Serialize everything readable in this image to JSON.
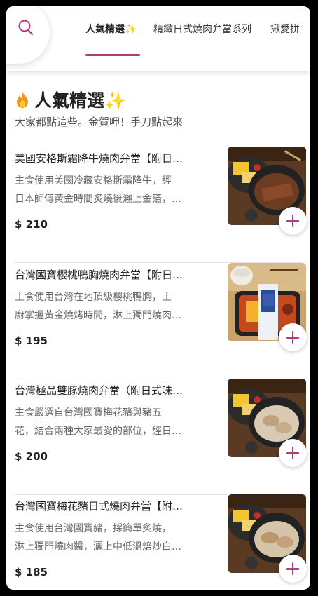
{
  "tabs": [
    {
      "label": "人氣精選✨"
    },
    {
      "label": "精緻日式燒肉弁當系列"
    },
    {
      "label": "揪愛拼"
    }
  ],
  "section": {
    "title": "人氣精選✨",
    "subtitle": "大家都點這些。金賀呷！手刀點起來"
  },
  "items": [
    {
      "name": "美國安格斯霜降牛燒肉弁當【附日…",
      "desc_line1": "主食使用美國冷藏安格斯霜降牛，經",
      "desc_line2": "日本師傅黃金時間炙燒後灑上金箔，…",
      "price": "$ 210"
    },
    {
      "name": "台灣國寶櫻桃鴨胸燒肉弁當【附日…",
      "desc_line1": "主食使用台灣在地頂級櫻桃鴨胸，主",
      "desc_line2": "廚掌握黃金燒烤時間，淋上獨門燒肉…",
      "price": "$ 195"
    },
    {
      "name": "台灣極品雙豚燒肉弁當（附日式味…",
      "desc_line1": "主食嚴選自台灣國寶梅花豬與豬五",
      "desc_line2": "花，結合兩種大家最愛的部位，經日…",
      "price": "$ 200"
    },
    {
      "name": "台灣國寶梅花豬日式燒肉弁當【附…",
      "desc_line1": "主食使用台灣國寶豬，採簡單炙燒，",
      "desc_line2": "淋上獨門燒肉醬，灑上中低溫焙炒白…",
      "price": "$ 185"
    }
  ],
  "colors": {
    "accent": "#b03a7c"
  }
}
